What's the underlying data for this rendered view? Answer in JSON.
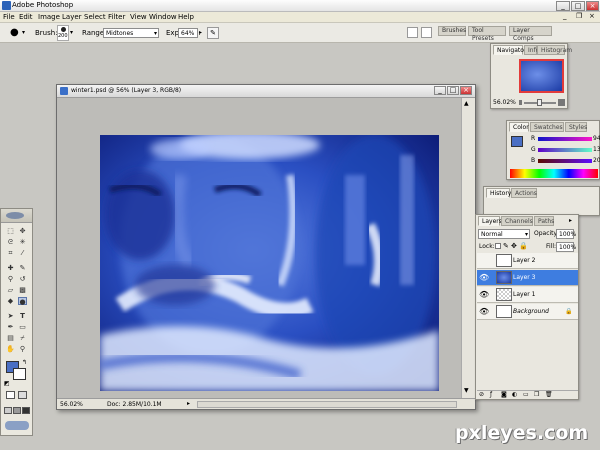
{
  "app": {
    "title": "Adobe Photoshop"
  },
  "menu": [
    "File",
    "Edit",
    "Image",
    "Layer",
    "Select",
    "Filter",
    "View",
    "Window",
    "Help"
  ],
  "options_bar": {
    "brush_label": "Brush:",
    "brush_size": "200",
    "range_label": "Range:",
    "range_value": "Midtones",
    "exposure_label": "Exposure:",
    "exposure_value": "64%",
    "well_tabs": [
      "Brushes",
      "Tool Presets",
      "Layer Comps"
    ]
  },
  "document": {
    "title": "winter1.psd @ 56% (Layer 3, RGB/8)",
    "zoom": "56.02%",
    "doc_info": "Doc: 2.85M/10.1M"
  },
  "navigator": {
    "tabs": [
      "Navigator",
      "Info",
      "Histogram"
    ],
    "zoom": "56.02%"
  },
  "color_palette": {
    "tabs": [
      "Color",
      "Swatches",
      "Styles"
    ],
    "channels": [
      {
        "label": "R",
        "value": "94"
      },
      {
        "label": "G",
        "value": "13"
      },
      {
        "label": "B",
        "value": "20"
      }
    ],
    "foreground_color": "#4a6fc4"
  },
  "history": {
    "tabs": [
      "History",
      "Actions"
    ]
  },
  "layers": {
    "tabs": [
      "Layers",
      "Channels",
      "Paths"
    ],
    "blend_mode": "Normal",
    "opacity_label": "Opacity:",
    "opacity_value": "100%",
    "lock_label": "Lock:",
    "fill_label": "Fill:",
    "fill_value": "100%",
    "items": [
      {
        "name": "Layer 2",
        "visible": false,
        "selected": false
      },
      {
        "name": "Layer 3",
        "visible": true,
        "selected": true
      },
      {
        "name": "Layer 1",
        "visible": true,
        "selected": false
      },
      {
        "name": "Background",
        "visible": true,
        "selected": false
      }
    ]
  },
  "colors": {
    "accent": "#3e7de0",
    "workspace": "#c8c7c2",
    "artwork_dark": "#1a3aa8",
    "artwork_light": "#dfe9ff"
  },
  "watermark": "pxleyes.com"
}
